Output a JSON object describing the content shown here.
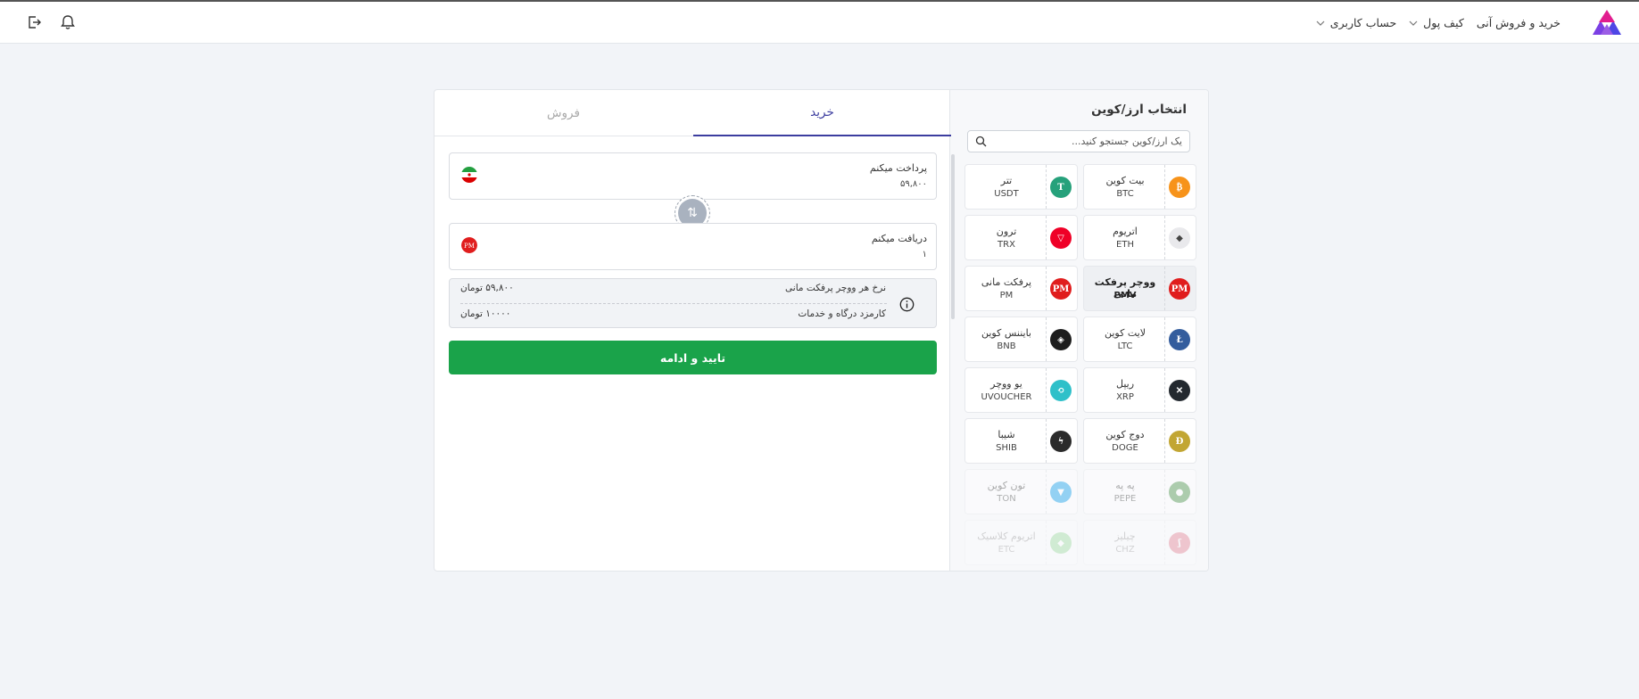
{
  "header": {
    "nav": [
      {
        "label": "خرید و فروش آنی",
        "dropdown": false
      },
      {
        "label": "کیف پول",
        "dropdown": true
      },
      {
        "label": "حساب کاربری",
        "dropdown": true
      }
    ],
    "icons": [
      "logo-icon",
      "bell-icon",
      "logout-icon"
    ]
  },
  "coins_panel": {
    "title": "انتخاب ارز/کوین",
    "search_placeholder": "یک ارز/کوین جستجو کنید...",
    "coins": [
      {
        "name": "بیت کوین",
        "symbol": "BTC",
        "color": "#f7931a",
        "icon": "bitcoin-icon"
      },
      {
        "name": "تتر",
        "symbol": "USDT",
        "color": "#26a17b",
        "icon": "tether-icon"
      },
      {
        "name": "اتریوم",
        "symbol": "ETH",
        "color": "#e9e9ec",
        "icon": "ethereum-icon"
      },
      {
        "name": "ترون",
        "symbol": "TRX",
        "color": "#ef0027",
        "icon": "tron-icon"
      },
      {
        "name": "ووچر پرفکت مانی",
        "symbol": "PMV",
        "color": "#e01d1d",
        "icon": "perfect-money-icon",
        "selected": true
      },
      {
        "name": "پرفکت مانی",
        "symbol": "PM",
        "color": "#e01d1d",
        "icon": "perfect-money-icon"
      },
      {
        "name": "لایت کوین",
        "symbol": "LTC",
        "color": "#345d9d",
        "icon": "litecoin-icon"
      },
      {
        "name": "بایننس کوین",
        "symbol": "BNB",
        "color": "#1e1e1e",
        "icon": "bnb-icon"
      },
      {
        "name": "ریپل",
        "symbol": "XRP",
        "color": "#23292f",
        "icon": "xrp-icon"
      },
      {
        "name": "یو ووچر",
        "symbol": "UVOUCHER",
        "color": "#2fc0c9",
        "icon": "uvoucher-icon"
      },
      {
        "name": "دوج کوین",
        "symbol": "DOGE",
        "color": "#c2a633",
        "icon": "dogecoin-icon"
      },
      {
        "name": "شیبا",
        "symbol": "SHIB",
        "color": "#2b2b2b",
        "icon": "shiba-icon"
      },
      {
        "name": "په په",
        "symbol": "PEPE",
        "color": "#3d8b3d",
        "icon": "pepe-icon"
      },
      {
        "name": "تون کوین",
        "symbol": "TON",
        "color": "#0098ea",
        "icon": "toncoin-icon"
      },
      {
        "name": "چیلیز",
        "symbol": "CHZ",
        "color": "#cd0124",
        "icon": "chiliz-icon"
      },
      {
        "name": "اتریوم کلاسیک",
        "symbol": "ETC",
        "color": "#3ab83a",
        "icon": "ethereum-classic-icon"
      }
    ]
  },
  "trade": {
    "tabs": {
      "buy": "خرید",
      "sell": "فروش"
    },
    "pay": {
      "label": "پرداخت میکنم",
      "value": "۵۹,۸۰۰"
    },
    "receive": {
      "label": "دریافت میکنم",
      "value": "۱"
    },
    "info": {
      "rate_label": "نرخ هر ووچر پرفکت مانی",
      "rate_value": "۵۹,۸۰۰ تومان",
      "fee_label": "کارمزد درگاه و خدمات",
      "fee_value": "۱۰۰۰۰ تومان"
    },
    "submit_label": "تایید و ادامه"
  }
}
